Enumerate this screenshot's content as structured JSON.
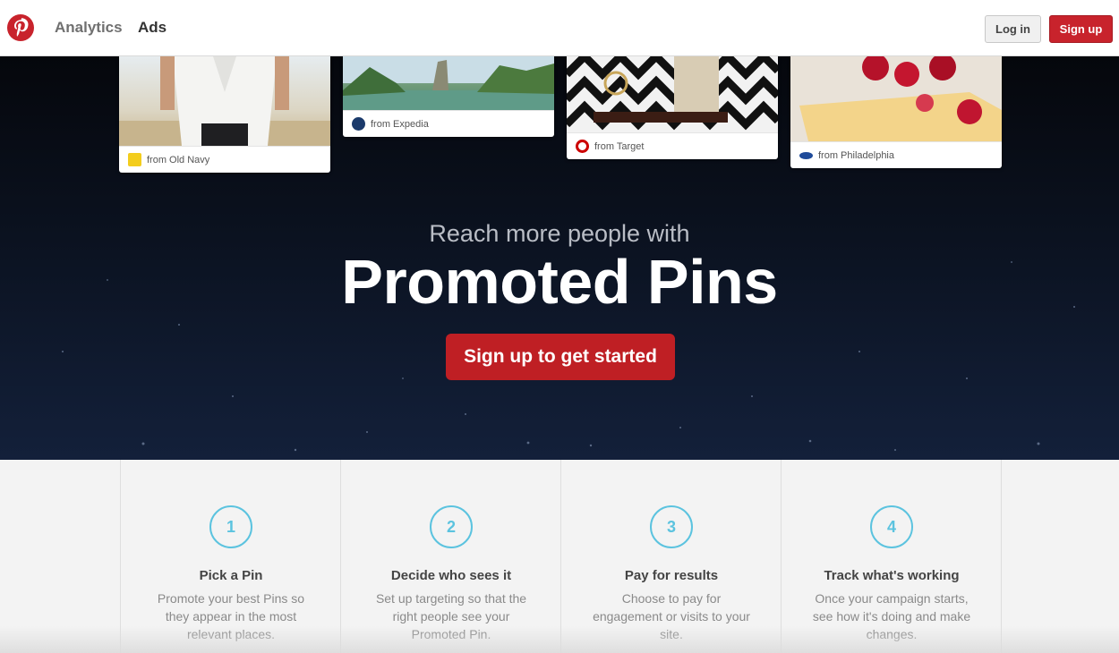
{
  "nav": {
    "logo_icon": "pinterest-logo-icon",
    "links": [
      {
        "label": "Analytics"
      },
      {
        "label": "Ads"
      }
    ],
    "login_label": "Log in",
    "signup_label": "Sign up",
    "brand_color": "#c8232c"
  },
  "hero": {
    "subtitle": "Reach more people with",
    "title": "Promoted Pins",
    "cta_label": "Sign up to get started",
    "cta_color": "#bf1f24",
    "pins": [
      {
        "source": "from Old Navy",
        "icon": "old-navy-icon"
      },
      {
        "source": "from Expedia",
        "icon": "expedia-icon"
      },
      {
        "source": "from Target",
        "icon": "target-icon"
      },
      {
        "source": "from Philadelphia",
        "icon": "philadelphia-icon"
      }
    ]
  },
  "steps": [
    {
      "number": "1",
      "title": "Pick a Pin",
      "description": "Promote your best Pins so they appear in the most relevant places."
    },
    {
      "number": "2",
      "title": "Decide who sees it",
      "description": "Set up targeting so that the right people see your Promoted Pin."
    },
    {
      "number": "3",
      "title": "Pay for results",
      "description": "Choose to pay for engagement or visits to your site."
    },
    {
      "number": "4",
      "title": "Track what's working",
      "description": "Once your campaign starts, see how it's doing and make changes."
    }
  ],
  "step_accent_color": "#5bc3df"
}
